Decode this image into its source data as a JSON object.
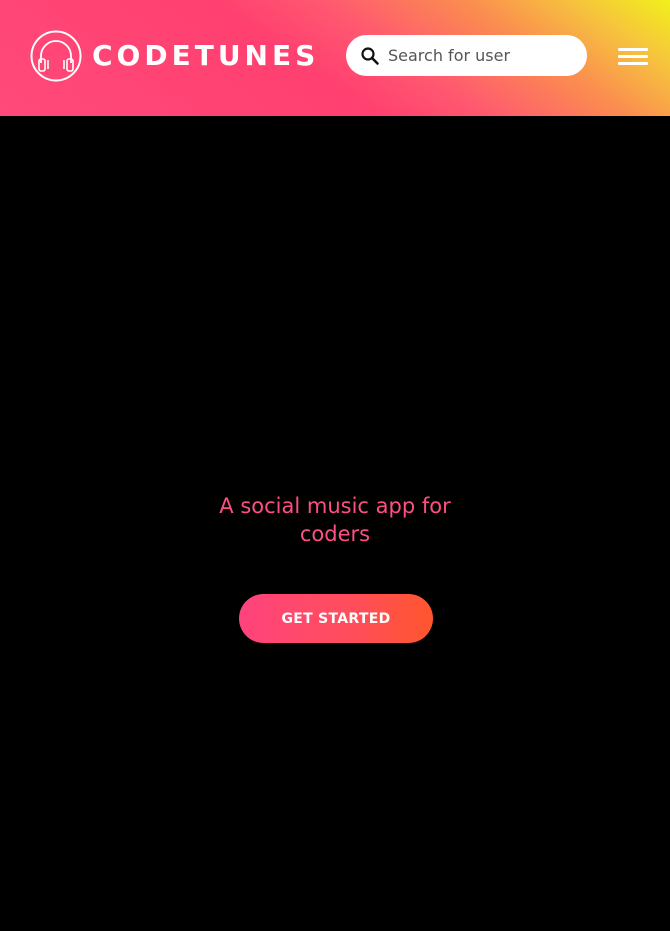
{
  "header": {
    "brand": "CODETUNES",
    "logo_icon": "headphones-icon",
    "search": {
      "icon": "search-icon",
      "placeholder": "Search for user",
      "value": ""
    },
    "menu_icon": "hamburger-menu-icon"
  },
  "hero": {
    "tagline": "A social music app for coders",
    "cta_label": "GET STARTED"
  },
  "colors": {
    "background": "#000000",
    "accent_pink": "#ff4f82",
    "gradient_start": "#ff4070",
    "gradient_mid": "#fb8c50",
    "gradient_end": "#f2f01c",
    "cta_start": "#ff437d",
    "cta_end": "#ff562c"
  }
}
